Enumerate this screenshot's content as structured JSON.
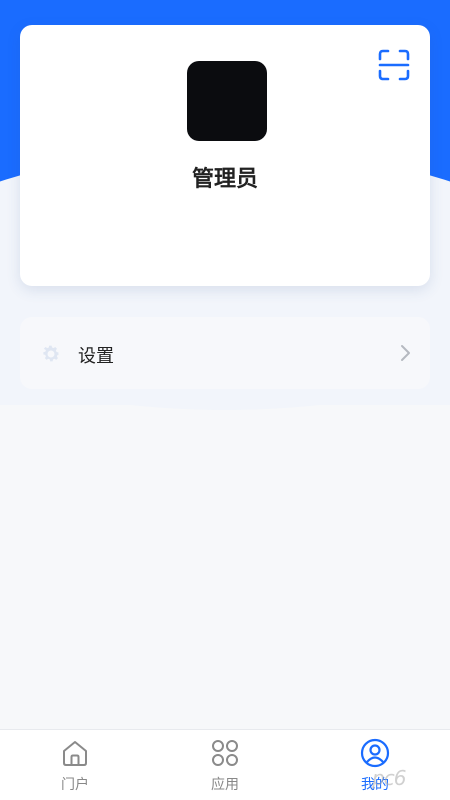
{
  "profile": {
    "name": "管理员",
    "scan_icon": "scan-icon"
  },
  "menu": {
    "items": [
      {
        "label": "设置",
        "icon": "gear-icon"
      }
    ]
  },
  "tabbar": {
    "active_index": 2,
    "active_color": "#1a6cff",
    "inactive_color": "#888888",
    "tabs": [
      {
        "label": "门户",
        "icon": "home-icon"
      },
      {
        "label": "应用",
        "icon": "apps-icon"
      },
      {
        "label": "我的",
        "icon": "user-icon"
      }
    ]
  },
  "theme": {
    "brand": "#1a6cff",
    "background": "#f7f8fa"
  },
  "watermark": "pc6"
}
